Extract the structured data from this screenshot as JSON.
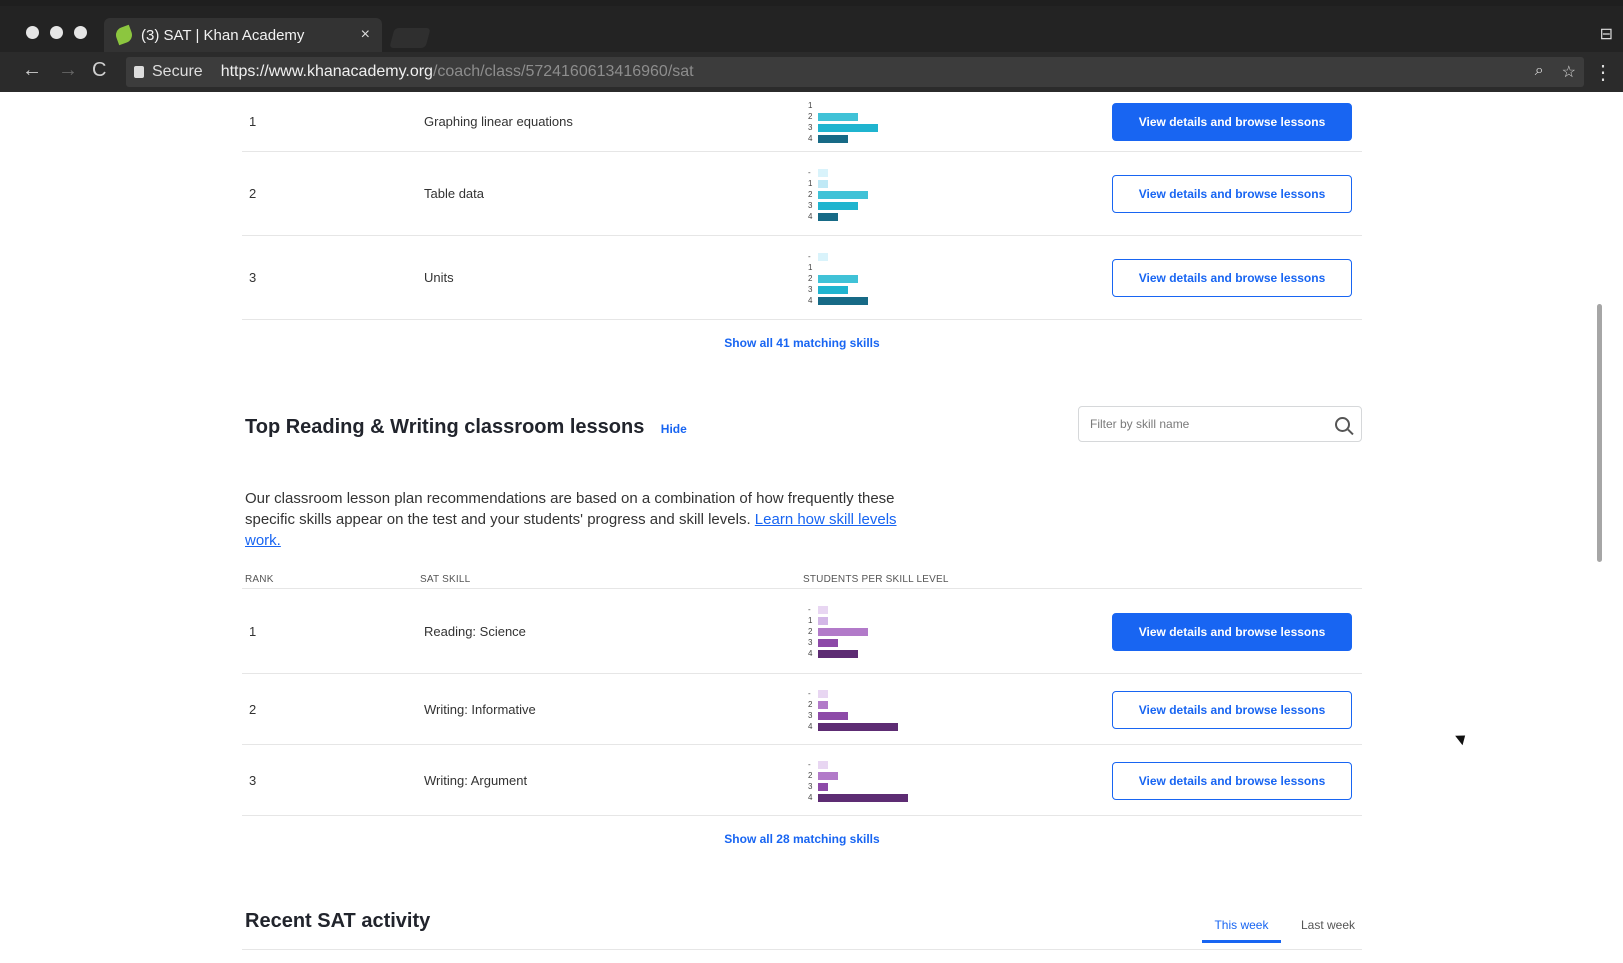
{
  "browser": {
    "tab_title": "(3) SAT | Khan Academy",
    "close_glyph": "×",
    "profile_glyph": "⊟",
    "back_glyph": "←",
    "forward_glyph": "→",
    "reload_glyph": "C",
    "secure_label": "Secure",
    "url_host": "https://www.khanacademy.org",
    "url_path": "/coach/class/5724160613416960/sat",
    "zoom_glyph": "⌕",
    "star_glyph": "☆",
    "menu_glyph": "⋮"
  },
  "math": {
    "rows": [
      {
        "rank": "1",
        "skill": "Graphing linear equations",
        "button": "View details and browse lessons",
        "primary": true,
        "bars": [
          {
            "label": "1",
            "value": 0
          },
          {
            "label": "2",
            "value": 4
          },
          {
            "label": "3",
            "value": 6
          },
          {
            "label": "4",
            "value": 3
          }
        ]
      },
      {
        "rank": "2",
        "skill": "Table data",
        "button": "View details and browse lessons",
        "primary": false,
        "bars": [
          {
            "label": "-",
            "value": 1
          },
          {
            "label": "1",
            "value": 1
          },
          {
            "label": "2",
            "value": 5
          },
          {
            "label": "3",
            "value": 4
          },
          {
            "label": "4",
            "value": 2
          }
        ]
      },
      {
        "rank": "3",
        "skill": "Units",
        "button": "View details and browse lessons",
        "primary": false,
        "bars": [
          {
            "label": "-",
            "value": 1
          },
          {
            "label": "1",
            "value": 0
          },
          {
            "label": "2",
            "value": 4
          },
          {
            "label": "3",
            "value": 3
          },
          {
            "label": "4",
            "value": 5
          }
        ]
      }
    ],
    "show_all": "Show all 41 matching skills",
    "colors": {
      "-": "#d9f3fb",
      "1": "#bfe9f6",
      "2": "#40c2d7",
      "3": "#1fb4cf",
      "4": "#176a86"
    }
  },
  "reading": {
    "title": "Top Reading & Writing classroom lessons",
    "hide": "Hide",
    "filter_placeholder": "Filter by skill name",
    "description": "Our classroom lesson plan recommendations are based on a combination of how frequently these specific skills appear on the test and your students' progress and skill levels.",
    "learn_link": "Learn how skill levels work.",
    "headers": {
      "rank": "RANK",
      "skill": "SAT SKILL",
      "students": "STUDENTS PER SKILL LEVEL"
    },
    "rows": [
      {
        "rank": "1",
        "skill": "Reading: Science",
        "button": "View details and browse lessons",
        "primary": true,
        "bars": [
          {
            "label": "-",
            "value": 1
          },
          {
            "label": "1",
            "value": 1
          },
          {
            "label": "2",
            "value": 5
          },
          {
            "label": "3",
            "value": 2
          },
          {
            "label": "4",
            "value": 4
          }
        ]
      },
      {
        "rank": "2",
        "skill": "Writing: Informative",
        "button": "View details and browse lessons",
        "primary": false,
        "bars": [
          {
            "label": "-",
            "value": 1
          },
          {
            "label": "2",
            "value": 1
          },
          {
            "label": "3",
            "value": 3
          },
          {
            "label": "4",
            "value": 8
          }
        ]
      },
      {
        "rank": "3",
        "skill": "Writing: Argument",
        "button": "View details and browse lessons",
        "primary": false,
        "bars": [
          {
            "label": "-",
            "value": 1
          },
          {
            "label": "2",
            "value": 2
          },
          {
            "label": "3",
            "value": 1
          },
          {
            "label": "4",
            "value": 9
          }
        ]
      }
    ],
    "show_all": "Show all 28 matching skills",
    "colors": {
      "-": "#e8d6f2",
      "1": "#d3b7e7",
      "2": "#b27ac9",
      "3": "#8d4aa8",
      "4": "#5d2c73"
    }
  },
  "recent": {
    "title": "Recent SAT activity",
    "this_week": "This week",
    "last_week": "Last week"
  }
}
